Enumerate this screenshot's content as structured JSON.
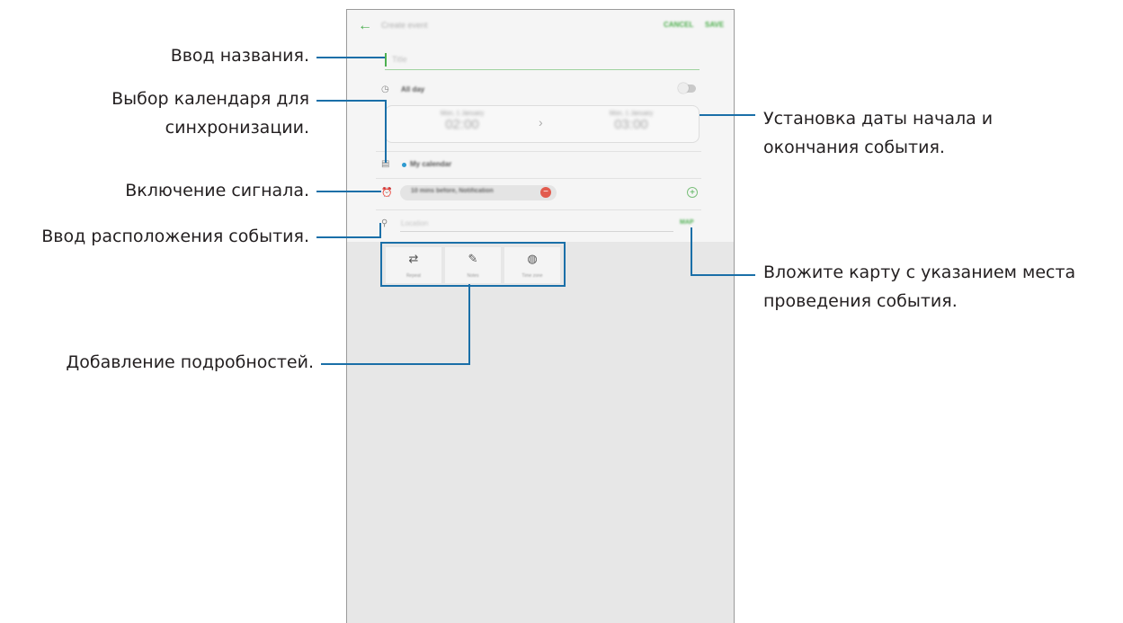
{
  "app": {
    "back_icon": "arrow-left-icon",
    "title": "Create event",
    "cancel_label": "CANCEL",
    "save_label": "SAVE",
    "accent_color": "#4caf50",
    "callout_color": "#1a6fa8"
  },
  "form": {
    "title_placeholder": "Title",
    "all_day_label": "All day",
    "start_date": "Mon, 1 January",
    "start_time": "02:00",
    "end_date": "Mon, 1 January",
    "end_time": "03:00",
    "calendar_label": "My calendar",
    "reminder_label": "10 mins before, Notification",
    "location_placeholder": "Location",
    "map_label": "MAP"
  },
  "details": [
    {
      "label": "Repeat",
      "icon": "repeat-icon"
    },
    {
      "label": "Notes",
      "icon": "notes-icon"
    },
    {
      "label": "Time zone",
      "icon": "time-zone-icon"
    }
  ],
  "callouts": {
    "title": "Ввод названия.",
    "calendar_line1": "Выбор календаря для",
    "calendar_line2": "синхронизации.",
    "alarm": "Включение сигнала.",
    "location": "Ввод расположения события.",
    "details": "Добавление подробностей.",
    "dates_line1": "Установка даты начала и",
    "dates_line2": "окончания события.",
    "map_line1": "Вложите карту с указанием места",
    "map_line2": "проведения события."
  }
}
